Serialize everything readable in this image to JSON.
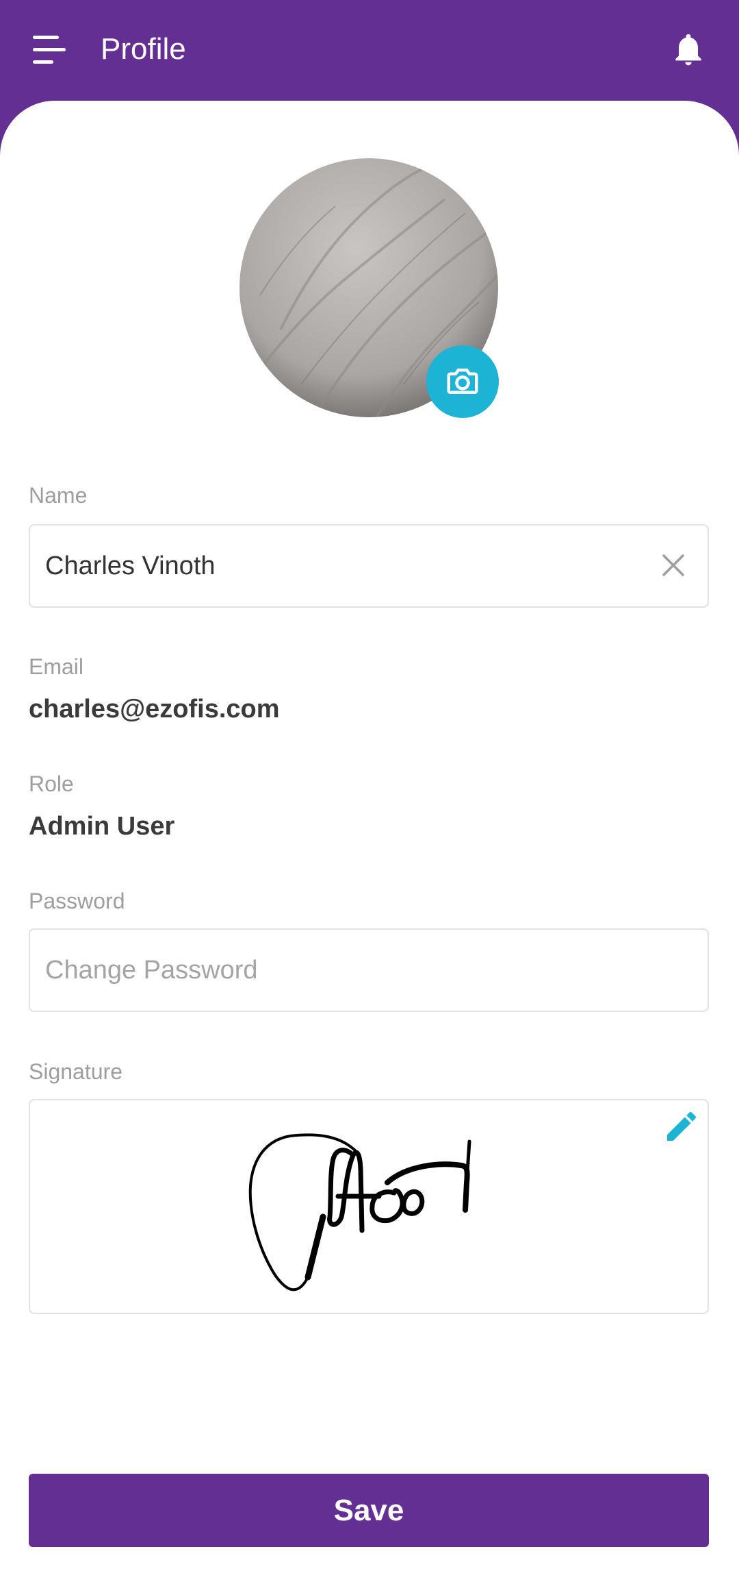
{
  "header": {
    "title": "Profile",
    "menu_icon": "menu-icon",
    "notification_icon": "bell-icon"
  },
  "profile": {
    "avatar_icon": "camera-icon"
  },
  "form": {
    "name": {
      "label": "Name",
      "value": "Charles Vinoth",
      "clear_icon": "close-icon"
    },
    "email": {
      "label": "Email",
      "value": "charles@ezofis.com"
    },
    "role": {
      "label": "Role",
      "value": "Admin User"
    },
    "password": {
      "label": "Password",
      "placeholder": "Change Password"
    },
    "signature": {
      "label": "Signature",
      "edit_icon": "pencil-icon"
    }
  },
  "actions": {
    "save_label": "Save"
  },
  "colors": {
    "primary": "#632f93",
    "accent": "#1cb3d4",
    "label": "#9e9e9e",
    "text": "#3a3a3a",
    "border": "#e2e2e2"
  }
}
